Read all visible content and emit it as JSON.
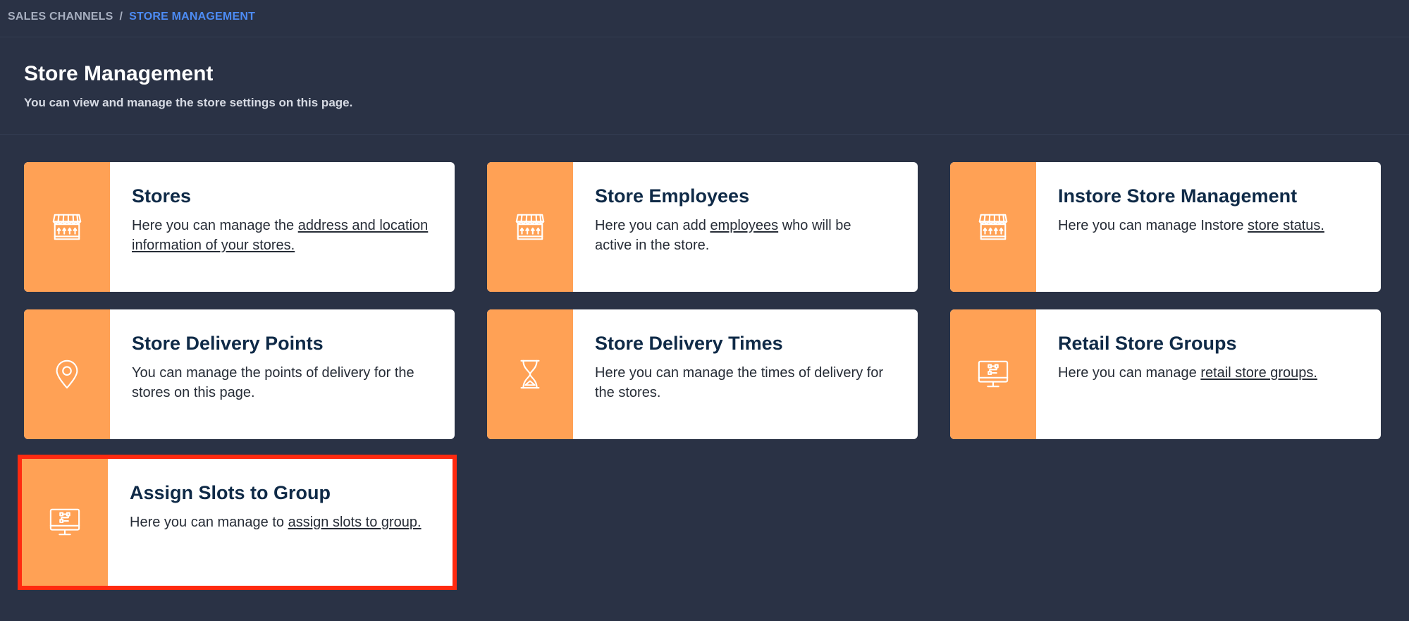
{
  "breadcrumb": {
    "parent": "SALES CHANNELS",
    "separator": "/",
    "current": "STORE MANAGEMENT"
  },
  "header": {
    "title": "Store Management",
    "subtitle": "You can view and manage the store settings on this page."
  },
  "colors": {
    "background": "#2a3245",
    "card_icon_panel": "#ffa155",
    "card_background": "#ffffff",
    "title_text": "#0f2a47",
    "breadcrumb_active": "#4d8cf5",
    "highlight_outline": "#ff2a10"
  },
  "cards": [
    {
      "icon": "storefront-icon",
      "title": "Stores",
      "desc_before": "Here you can manage the ",
      "desc_link": "address and location information of your stores.",
      "desc_after": ""
    },
    {
      "icon": "storefront-icon",
      "title": "Store Employees",
      "desc_before": "Here you can add ",
      "desc_link": "employees",
      "desc_after": " who will be active in the store."
    },
    {
      "icon": "storefront-icon",
      "title": "Instore Store Management",
      "desc_before": "Here you can manage Instore ",
      "desc_link": "store status.",
      "desc_after": ""
    },
    {
      "icon": "map-pin-icon",
      "title": "Store Delivery Points",
      "desc_before": "You can manage the points of delivery for the stores on this page.",
      "desc_link": "",
      "desc_after": ""
    },
    {
      "icon": "hourglass-icon",
      "title": "Store Delivery Times",
      "desc_before": "Here you can manage the times of delivery for the stores.",
      "desc_link": "",
      "desc_after": ""
    },
    {
      "icon": "monitor-network-icon",
      "title": "Retail Store Groups",
      "desc_before": "Here you can manage ",
      "desc_link": "retail store groups.",
      "desc_after": ""
    },
    {
      "icon": "monitor-network-icon",
      "title": "Assign Slots to Group",
      "desc_before": "Here you can manage to ",
      "desc_link": "assign slots to group.",
      "desc_after": ""
    }
  ]
}
